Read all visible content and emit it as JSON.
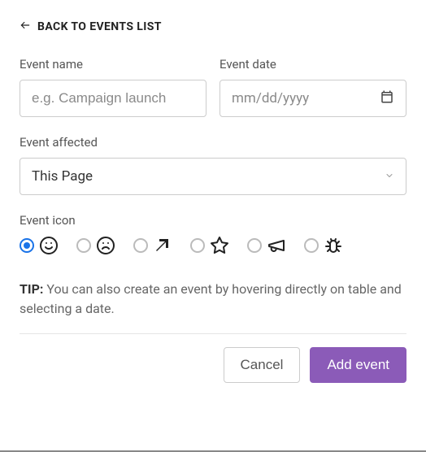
{
  "back_link": {
    "label": "BACK TO EVENTS LIST"
  },
  "fields": {
    "name": {
      "label": "Event name",
      "placeholder": "e.g. Campaign launch",
      "value": ""
    },
    "date": {
      "label": "Event date",
      "placeholder": "mm/dd/yyyy",
      "value": ""
    },
    "affected": {
      "label": "Event affected",
      "value": "This Page"
    },
    "icon": {
      "label": "Event icon",
      "selected_index": 0
    }
  },
  "icon_options": [
    {
      "name": "smile-icon"
    },
    {
      "name": "frown-icon"
    },
    {
      "name": "arrow-up-right-icon"
    },
    {
      "name": "star-icon"
    },
    {
      "name": "megaphone-icon"
    },
    {
      "name": "bug-icon"
    }
  ],
  "tip": {
    "prefix": "TIP:",
    "text": " You can also create an event by hovering directly on table and selecting a date."
  },
  "buttons": {
    "cancel": "Cancel",
    "submit": "Add event"
  },
  "colors": {
    "primary": "#8b5bb8",
    "radio_selected": "#1a73e8"
  }
}
